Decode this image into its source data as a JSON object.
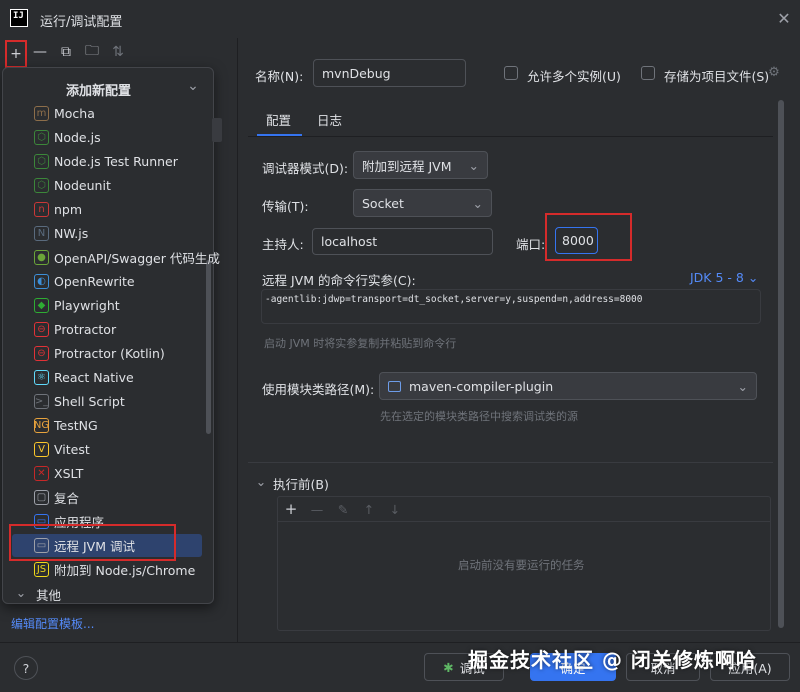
{
  "window": {
    "app_icon_text": "IJ",
    "title": "运行/调试配置",
    "close": "✕"
  },
  "toolbar": {
    "add": "+",
    "remove": "—",
    "copy": "⧉",
    "folder": "🗀",
    "sort": "⇅"
  },
  "popup": {
    "title": "添加新配置",
    "collapse": "⌄",
    "items": [
      {
        "label": "Mocha",
        "icon": "m",
        "icon_color": "#8d6e4a"
      },
      {
        "label": "Node.js",
        "icon": "⬡",
        "icon_color": "#3c873a"
      },
      {
        "label": "Node.js Test Runner",
        "icon": "⬡",
        "icon_color": "#3c873a"
      },
      {
        "label": "Nodeunit",
        "icon": "⬡",
        "icon_color": "#3c873a"
      },
      {
        "label": "npm",
        "icon": "n",
        "icon_color": "#cb3837"
      },
      {
        "label": "NW.js",
        "icon": "N",
        "icon_color": "#5a6b7e"
      },
      {
        "label": "OpenAPI/Swagger 代码生成",
        "icon": "●",
        "icon_color": "#6ba539"
      },
      {
        "label": "OpenRewrite",
        "icon": "◐",
        "icon_color": "#3d8fd8"
      },
      {
        "label": "Playwright",
        "icon": "◆",
        "icon_color": "#2ead33"
      },
      {
        "label": "Protractor",
        "icon": "⊖",
        "icon_color": "#e23237"
      },
      {
        "label": "Protractor (Kotlin)",
        "icon": "⊖",
        "icon_color": "#e23237"
      },
      {
        "label": "React Native",
        "icon": "⚛",
        "icon_color": "#61dafb"
      },
      {
        "label": "Shell Script",
        "icon": ">_",
        "icon_color": "#6f737a"
      },
      {
        "label": "TestNG",
        "icon": "NG",
        "icon_color": "#e8a33d"
      },
      {
        "label": "Vitest",
        "icon": "V",
        "icon_color": "#fcc72b"
      },
      {
        "label": "XSLT",
        "icon": "✕",
        "icon_color": "#c62828"
      },
      {
        "label": "复合",
        "icon": "▢",
        "icon_color": "#9da0a8"
      },
      {
        "label": "应用程序",
        "icon": "▭",
        "icon_color": "#3574f0"
      },
      {
        "label": "远程 JVM 调试",
        "icon": "▭",
        "icon_color": "#9da0a8"
      },
      {
        "label": "附加到 Node.js/Chrome",
        "icon": "JS",
        "icon_color": "#f0d91b"
      }
    ],
    "group_other": "其他",
    "group_chevron": "⌄"
  },
  "edit_templates": "编辑配置模板...",
  "help": "?",
  "form": {
    "name_label": "名称(N):",
    "name_value": "mvnDebug",
    "allow_parallel": "允许多个实例(U)",
    "store_project": "存储为项目文件(S)",
    "gear": "⚙",
    "tabs": [
      "配置",
      "日志"
    ],
    "debugger_mode_label": "调试器模式(D):",
    "debugger_mode_value": "附加到远程 JVM",
    "transport_label": "传输(T):",
    "transport_value": "Socket",
    "host_label": "主持人:",
    "host_value": "localhost",
    "port_label": "端口:",
    "port_value": "8000",
    "cmdline_label": "远程 JVM 的命令行实参(C):",
    "jdk_link": "JDK 5 - 8",
    "cmdline_value": "-agentlib:jdwp=transport=dt_socket,server=y,suspend=n,address=8000",
    "cmdline_hint": "启动 JVM 时将实参复制并粘贴到命令行",
    "module_label": "使用模块类路径(M):",
    "module_value": "maven-compiler-plugin",
    "module_hint": "先在选定的模块类路径中搜索调试类的源",
    "before_launch": "执行前(B)",
    "before_empty": "启动前没有要运行的任务",
    "bl_tools": [
      "+",
      "—",
      "✎",
      "↑",
      "↓"
    ]
  },
  "buttons": {
    "debug": "调试",
    "ok": "确定",
    "cancel": "取消",
    "apply": "应用(A)"
  },
  "watermark": "掘金技术社区 @ 闭关修炼啊哈"
}
